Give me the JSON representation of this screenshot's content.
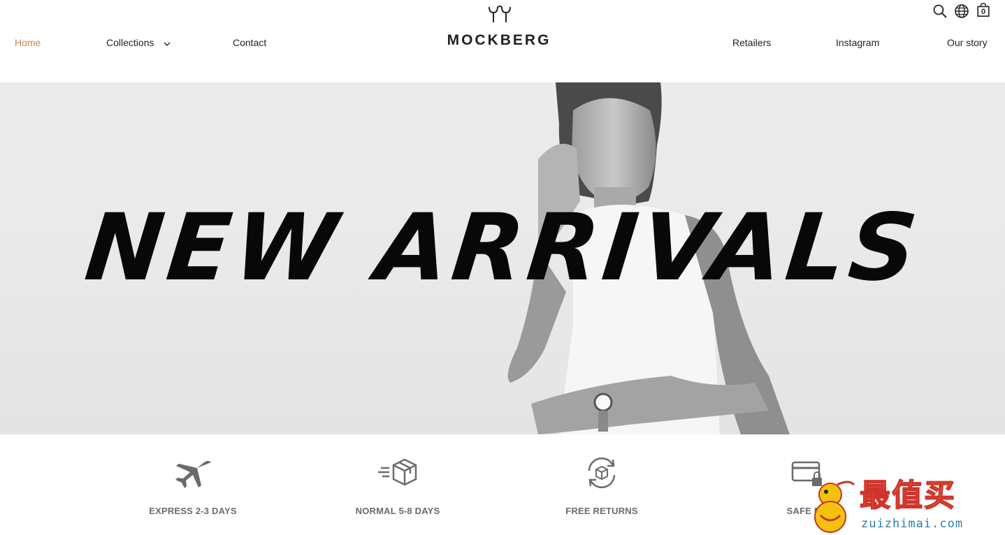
{
  "header": {
    "nav_left": [
      {
        "label": "Home",
        "active": true
      },
      {
        "label": "Collections",
        "has_dropdown": true
      },
      {
        "label": "Contact"
      }
    ],
    "nav_right": [
      {
        "label": "Retailers"
      },
      {
        "label": "Instagram"
      },
      {
        "label": "Our story"
      }
    ],
    "logo_text": "MOCKBERG",
    "bag_count": "0",
    "icons": [
      "search-icon",
      "globe-icon",
      "bag-icon",
      "chevron-down-icon"
    ],
    "active_color": "#c4865a"
  },
  "hero": {
    "title": "NEW ARRIVALS"
  },
  "features": [
    {
      "label": "EXPRESS 2-3 DAYS",
      "icon": "airplane-icon"
    },
    {
      "label": "NORMAL 5-8 DAYS",
      "icon": "package-icon"
    },
    {
      "label": "FREE RETURNS",
      "icon": "returns-icon"
    },
    {
      "label": "SAFE PA",
      "icon": "card-lock-icon"
    }
  ],
  "watermark": {
    "text": "最值买",
    "url": "zuizhimai.com"
  }
}
